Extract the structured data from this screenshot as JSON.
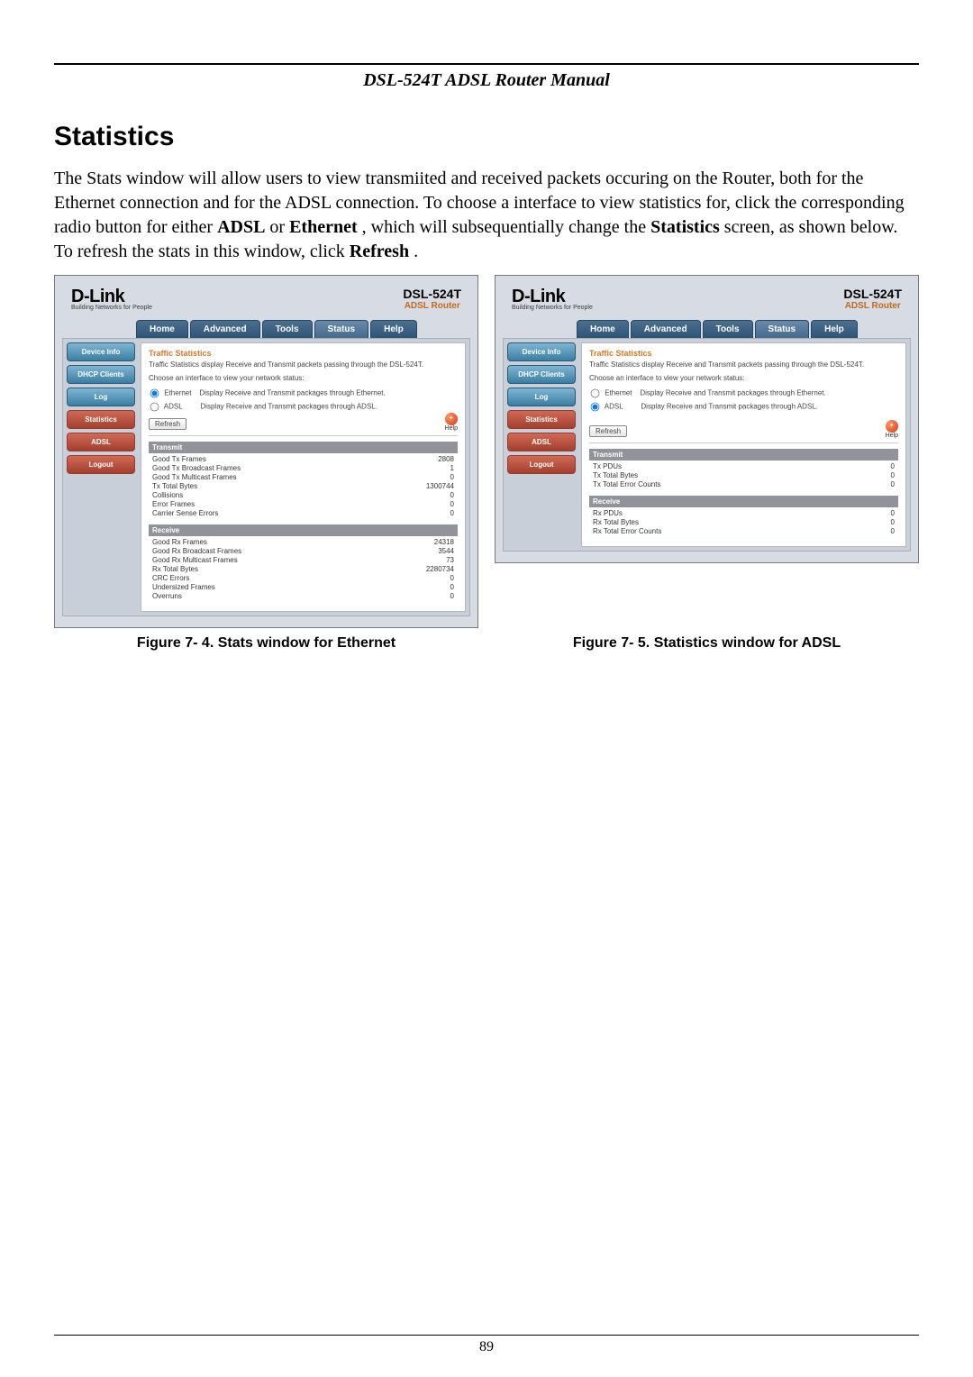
{
  "header": {
    "title": "DSL-524T ADSL Router Manual"
  },
  "section": {
    "heading": "Statistics"
  },
  "paragraph": {
    "part1": "The Stats window will allow users to view transmiited and received packets occuring on the Router, both for the Ethernet connection and for the ADSL connection. To choose a interface to view statistics for, click the corresponding radio button for either ",
    "b1": "ADSL",
    "part2": " or ",
    "b2": "Ethernet",
    "part3": ", which will subsequentially change the ",
    "b3": "Statistics",
    "part4": " screen, as shown below. To refresh the stats in this window, click ",
    "b4": "Refresh",
    "part5": "."
  },
  "figure_captions": {
    "left": "Figure 7- 4. Stats window for Ethernet",
    "right": "Figure 7- 5. Statistics window for ADSL"
  },
  "router_ui": {
    "brand": "D-Link",
    "brand_sub": "Building Networks for People",
    "device": {
      "name": "DSL-524T",
      "sub": "ADSL Router"
    },
    "tabs": {
      "home": "Home",
      "advanced": "Advanced",
      "tools": "Tools",
      "status": "Status",
      "help": "Help"
    },
    "sidebar": {
      "device_info": "Device Info",
      "dhcp_clients": "DHCP Clients",
      "log": "Log",
      "statistics": "Statistics",
      "adsl": "ADSL",
      "logout": "Logout"
    },
    "pane": {
      "title": "Traffic Statistics",
      "intro": "Traffic Statistics display Receive and Transmit packets passing through the DSL-524T.",
      "choose": "Choose an interface to view your network status:",
      "radio_ethernet": "Ethernet",
      "radio_ethernet_desc": "Display Receive and Transmit packages through Ethernet.",
      "radio_adsl": "ADSL",
      "radio_adsl_desc": "Display Receive and Transmit packages through ADSL.",
      "refresh": "Refresh",
      "help_label": "Help"
    }
  },
  "ethernet_stats": {
    "transmit_hdr": "Transmit",
    "receive_hdr": "Receive",
    "tx": {
      "good_tx_frames": {
        "label": "Good Tx Frames",
        "value": "2808"
      },
      "good_tx_broadcast": {
        "label": "Good Tx Broadcast Frames",
        "value": "1"
      },
      "good_tx_multicast": {
        "label": "Good Tx Multicast Frames",
        "value": "0"
      },
      "tx_total_bytes": {
        "label": "Tx Total Bytes",
        "value": "1300744"
      },
      "collisions": {
        "label": "Collisions",
        "value": "0"
      },
      "error_frames": {
        "label": "Error Frames",
        "value": "0"
      },
      "carrier_sense": {
        "label": "Carrier Sense Errors",
        "value": "0"
      }
    },
    "rx": {
      "good_rx_frames": {
        "label": "Good Rx Frames",
        "value": "24318"
      },
      "good_rx_broadcast": {
        "label": "Good Rx Broadcast Frames",
        "value": "3544"
      },
      "good_rx_multicast": {
        "label": "Good Rx Multicast Frames",
        "value": "73"
      },
      "rx_total_bytes": {
        "label": "Rx Total Bytes",
        "value": "2280734"
      },
      "crc_errors": {
        "label": "CRC Errors",
        "value": "0"
      },
      "undersized": {
        "label": "Undersized Frames",
        "value": "0"
      },
      "overruns": {
        "label": "Overruns",
        "value": "0"
      }
    }
  },
  "adsl_stats": {
    "transmit_hdr": "Transmit",
    "receive_hdr": "Receive",
    "tx": {
      "tx_pdus": {
        "label": "Tx PDUs",
        "value": "0"
      },
      "tx_total_bytes": {
        "label": "Tx Total Bytes",
        "value": "0"
      },
      "tx_total_err": {
        "label": "Tx Total Error Counts",
        "value": "0"
      }
    },
    "rx": {
      "rx_pdus": {
        "label": "Rx PDUs",
        "value": "0"
      },
      "rx_total_bytes": {
        "label": "Rx Total Bytes",
        "value": "0"
      },
      "rx_total_err": {
        "label": "Rx Total Error Counts",
        "value": "0"
      }
    }
  },
  "page_number": "89"
}
